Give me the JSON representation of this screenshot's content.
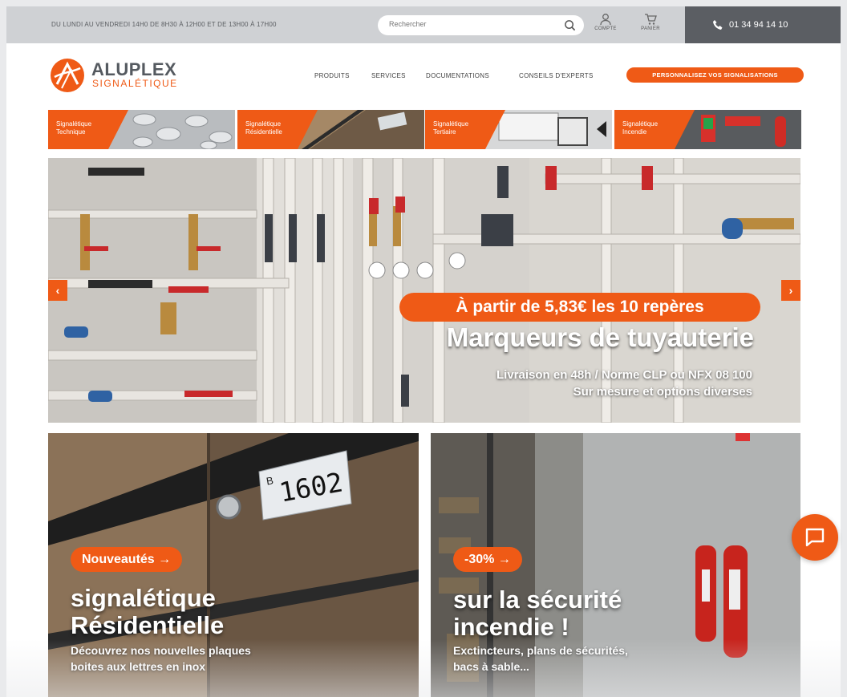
{
  "topbar": {
    "hours": "DU LUNDI AU VENDREDI 14H0 DE 8H30 À 12H00 ET DE 13H00 À 17H00",
    "search_placeholder": "Rechercher",
    "account_label": "COMPTE",
    "cart_label": "PANIER",
    "phone": "01 34 94 14 10"
  },
  "header": {
    "brand": "ALUPLEX",
    "brand_sub": "SIGNALÉTIQUE",
    "nav": [
      "PRODUITS",
      "SERVICES",
      "DOCUMENTATIONS",
      "CONSEILS D'EXPERTS"
    ],
    "cta": "PERSONNALISEZ VOS SIGNALISATIONS"
  },
  "categories": [
    {
      "label": "Signalétique Technique"
    },
    {
      "label": "Signalétique Résidentielle"
    },
    {
      "label": "Signalétique Tertiaire"
    },
    {
      "label": "Signalétique Incendie"
    }
  ],
  "hero": {
    "badge": "À partir de 5,83€ les 10 repères",
    "title": "Marqueurs de tuyauterie",
    "sub1": "Livraison en 48h / Norme CLP ou NFX 08 100",
    "sub2": "Sur mesure et options diverses",
    "prev": "‹",
    "next": "›"
  },
  "cards": [
    {
      "pill": "Nouveautés",
      "title1": "signalétique",
      "title2": "Résidentielle",
      "text1": "Découvrez nos nouvelles plaques",
      "text2": "boites aux lettres en inox",
      "plate_letter": "B",
      "plate_number": "1602"
    },
    {
      "pill": "-30%",
      "title1": "sur la sécurité",
      "title2": "incendie !",
      "text1": "Exctincteurs, plans de sécurités,",
      "text2": "bacs à sable..."
    }
  ],
  "colors": {
    "accent": "#ef5a16",
    "topbar": "#cfd1d4",
    "phone_bg": "#5b5e63"
  }
}
